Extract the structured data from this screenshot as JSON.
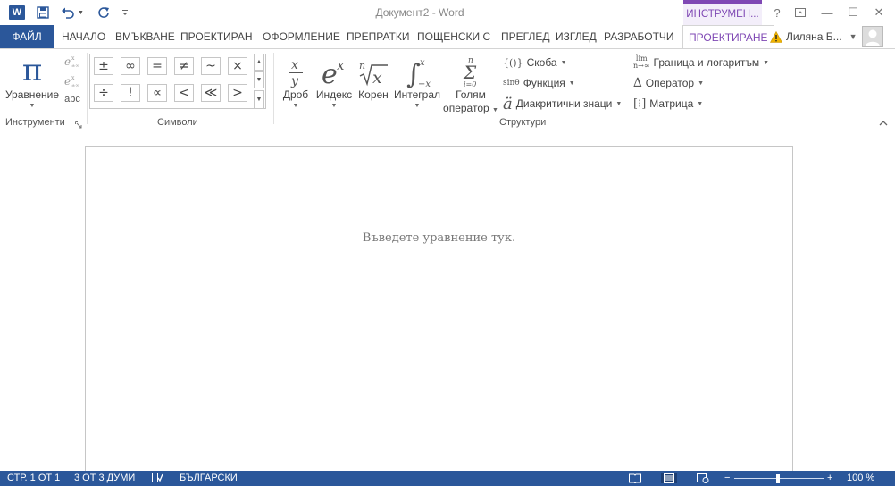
{
  "titlebar": {
    "app_icon_letter": "W",
    "document_title": "Документ2 - Word",
    "context_tab_title": "ИНСТРУМЕН...",
    "help_label": "?",
    "minimize_label": "—",
    "maximize_label": "☐",
    "close_label": "✕"
  },
  "tabs": {
    "file": "ФАЙЛ",
    "home": "НАЧАЛО",
    "insert": "ВМЪКВАНЕ",
    "design": "ПРОЕКТИРАН",
    "layout": "ОФОРМЛЕНИЕ",
    "references": "ПРЕПРАТКИ",
    "mailings": "ПОЩЕНСКИ С",
    "review": "ПРЕГЛЕД",
    "view": "ИЗГЛЕД",
    "developer": "РАЗРАБОТЧИ",
    "equation_design": "ПРОЕКТИРАНЕ"
  },
  "user": {
    "name": "Лиляна Б..."
  },
  "ribbon": {
    "tools": {
      "group_label": "Инструменти",
      "equation_label": "Уравнение",
      "equation_glyph": "π",
      "abc_label": "abc"
    },
    "symbols": {
      "group_label": "Символи",
      "items": [
        "±",
        "∞",
        "=",
        "≠",
        "~",
        "×",
        "÷",
        "!",
        "∝",
        "<",
        "≪",
        ">"
      ]
    },
    "structures": {
      "group_label": "Структури",
      "fraction": "Дроб",
      "script": "Индекс",
      "radical": "Корен",
      "integral": "Интеграл",
      "large_operator_line1": "Голям",
      "large_operator_line2": "оператор",
      "bracket": "Скоба",
      "function": "Функция",
      "accent": "Диакритични знаци",
      "limit_log": "Граница и логаритъм",
      "operator": "Оператор",
      "matrix": "Матрица"
    }
  },
  "document": {
    "equation_placeholder": "Въведете уравнение тук."
  },
  "statusbar": {
    "page": "СТР. 1 ОТ 1",
    "words": "3 ОТ 3 ДУМИ",
    "language": "БЪЛГАРСКИ",
    "zoom_minus": "−",
    "zoom_plus": "+",
    "zoom_level": "100 %"
  },
  "colors": {
    "word_blue": "#2b579a",
    "context_purple": "#7f48b4"
  }
}
